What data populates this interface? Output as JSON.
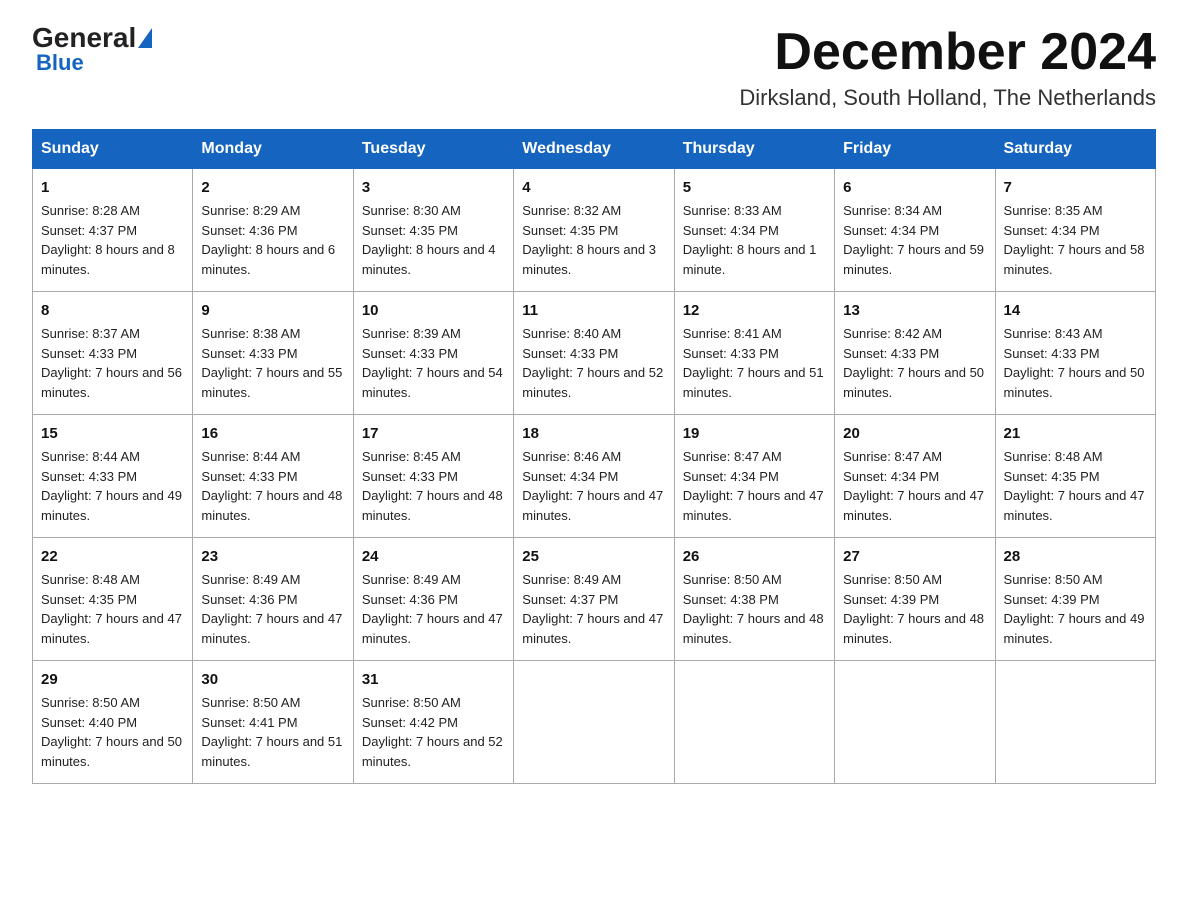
{
  "logo": {
    "general": "General",
    "blue": "Blue",
    "tagline": "Blue"
  },
  "title": "December 2024",
  "location": "Dirksland, South Holland, The Netherlands",
  "days_of_week": [
    "Sunday",
    "Monday",
    "Tuesday",
    "Wednesday",
    "Thursday",
    "Friday",
    "Saturday"
  ],
  "weeks": [
    [
      {
        "day": "1",
        "sunrise": "8:28 AM",
        "sunset": "4:37 PM",
        "daylight": "8 hours and 8 minutes."
      },
      {
        "day": "2",
        "sunrise": "8:29 AM",
        "sunset": "4:36 PM",
        "daylight": "8 hours and 6 minutes."
      },
      {
        "day": "3",
        "sunrise": "8:30 AM",
        "sunset": "4:35 PM",
        "daylight": "8 hours and 4 minutes."
      },
      {
        "day": "4",
        "sunrise": "8:32 AM",
        "sunset": "4:35 PM",
        "daylight": "8 hours and 3 minutes."
      },
      {
        "day": "5",
        "sunrise": "8:33 AM",
        "sunset": "4:34 PM",
        "daylight": "8 hours and 1 minute."
      },
      {
        "day": "6",
        "sunrise": "8:34 AM",
        "sunset": "4:34 PM",
        "daylight": "7 hours and 59 minutes."
      },
      {
        "day": "7",
        "sunrise": "8:35 AM",
        "sunset": "4:34 PM",
        "daylight": "7 hours and 58 minutes."
      }
    ],
    [
      {
        "day": "8",
        "sunrise": "8:37 AM",
        "sunset": "4:33 PM",
        "daylight": "7 hours and 56 minutes."
      },
      {
        "day": "9",
        "sunrise": "8:38 AM",
        "sunset": "4:33 PM",
        "daylight": "7 hours and 55 minutes."
      },
      {
        "day": "10",
        "sunrise": "8:39 AM",
        "sunset": "4:33 PM",
        "daylight": "7 hours and 54 minutes."
      },
      {
        "day": "11",
        "sunrise": "8:40 AM",
        "sunset": "4:33 PM",
        "daylight": "7 hours and 52 minutes."
      },
      {
        "day": "12",
        "sunrise": "8:41 AM",
        "sunset": "4:33 PM",
        "daylight": "7 hours and 51 minutes."
      },
      {
        "day": "13",
        "sunrise": "8:42 AM",
        "sunset": "4:33 PM",
        "daylight": "7 hours and 50 minutes."
      },
      {
        "day": "14",
        "sunrise": "8:43 AM",
        "sunset": "4:33 PM",
        "daylight": "7 hours and 50 minutes."
      }
    ],
    [
      {
        "day": "15",
        "sunrise": "8:44 AM",
        "sunset": "4:33 PM",
        "daylight": "7 hours and 49 minutes."
      },
      {
        "day": "16",
        "sunrise": "8:44 AM",
        "sunset": "4:33 PM",
        "daylight": "7 hours and 48 minutes."
      },
      {
        "day": "17",
        "sunrise": "8:45 AM",
        "sunset": "4:33 PM",
        "daylight": "7 hours and 48 minutes."
      },
      {
        "day": "18",
        "sunrise": "8:46 AM",
        "sunset": "4:34 PM",
        "daylight": "7 hours and 47 minutes."
      },
      {
        "day": "19",
        "sunrise": "8:47 AM",
        "sunset": "4:34 PM",
        "daylight": "7 hours and 47 minutes."
      },
      {
        "day": "20",
        "sunrise": "8:47 AM",
        "sunset": "4:34 PM",
        "daylight": "7 hours and 47 minutes."
      },
      {
        "day": "21",
        "sunrise": "8:48 AM",
        "sunset": "4:35 PM",
        "daylight": "7 hours and 47 minutes."
      }
    ],
    [
      {
        "day": "22",
        "sunrise": "8:48 AM",
        "sunset": "4:35 PM",
        "daylight": "7 hours and 47 minutes."
      },
      {
        "day": "23",
        "sunrise": "8:49 AM",
        "sunset": "4:36 PM",
        "daylight": "7 hours and 47 minutes."
      },
      {
        "day": "24",
        "sunrise": "8:49 AM",
        "sunset": "4:36 PM",
        "daylight": "7 hours and 47 minutes."
      },
      {
        "day": "25",
        "sunrise": "8:49 AM",
        "sunset": "4:37 PM",
        "daylight": "7 hours and 47 minutes."
      },
      {
        "day": "26",
        "sunrise": "8:50 AM",
        "sunset": "4:38 PM",
        "daylight": "7 hours and 48 minutes."
      },
      {
        "day": "27",
        "sunrise": "8:50 AM",
        "sunset": "4:39 PM",
        "daylight": "7 hours and 48 minutes."
      },
      {
        "day": "28",
        "sunrise": "8:50 AM",
        "sunset": "4:39 PM",
        "daylight": "7 hours and 49 minutes."
      }
    ],
    [
      {
        "day": "29",
        "sunrise": "8:50 AM",
        "sunset": "4:40 PM",
        "daylight": "7 hours and 50 minutes."
      },
      {
        "day": "30",
        "sunrise": "8:50 AM",
        "sunset": "4:41 PM",
        "daylight": "7 hours and 51 minutes."
      },
      {
        "day": "31",
        "sunrise": "8:50 AM",
        "sunset": "4:42 PM",
        "daylight": "7 hours and 52 minutes."
      },
      null,
      null,
      null,
      null
    ]
  ]
}
